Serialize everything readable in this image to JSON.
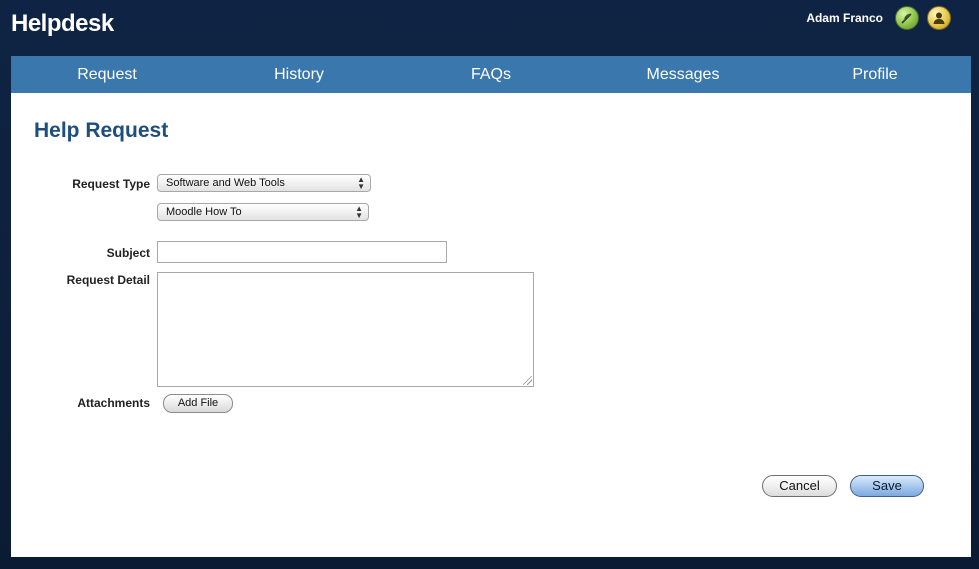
{
  "app": {
    "title": "Helpdesk"
  },
  "user": {
    "name": "Adam Franco"
  },
  "nav": {
    "items": [
      {
        "label": "Request"
      },
      {
        "label": "History"
      },
      {
        "label": "FAQs"
      },
      {
        "label": "Messages"
      },
      {
        "label": "Profile"
      }
    ]
  },
  "form": {
    "title": "Help Request",
    "request_type_label": "Request Type",
    "request_type_value": "Software and Web Tools",
    "request_subtype_value": "Moodle How To",
    "subject_label": "Subject",
    "subject_value": "",
    "detail_label": "Request Detail",
    "detail_value": "",
    "attachments_label": "Attachments",
    "add_file_label": "Add File",
    "cancel_label": "Cancel",
    "save_label": "Save"
  },
  "colors": {
    "header_bg": "#0f2444",
    "nav_bg": "#3a77ad",
    "title_color": "#1d4e7c"
  },
  "icons": {
    "user_tool": "gear-feather-icon",
    "user_account": "user-icon"
  }
}
